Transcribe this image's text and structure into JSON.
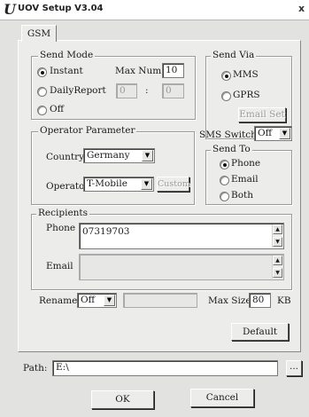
{
  "window": {
    "title": "UOV Setup V3.04",
    "close": "x"
  },
  "tabs": [
    {
      "label": "GSM"
    }
  ],
  "send_mode": {
    "label": "Send Mode",
    "instant": "Instant",
    "daily_report": "DailyReport",
    "off": "Off",
    "max_num_label": "Max Num",
    "max_num_value": "10",
    "daily_value_1": "0",
    "daily_separator": ":",
    "daily_value_2": "0",
    "selected": "Instant"
  },
  "send_via": {
    "label": "Send Via",
    "mms": "MMS",
    "gprs": "GPRS",
    "email_set": "Email Set",
    "selected": "MMS"
  },
  "operator_parameter": {
    "label": "Operator Parameter",
    "country_label": "Country",
    "country_value": "Germany",
    "operator_label": "Operator",
    "operator_value": "T-Mobile",
    "custom_button": "Custom"
  },
  "sms_switch": {
    "label": "SMS Switch",
    "value": "Off"
  },
  "send_to": {
    "label": "Send To",
    "phone": "Phone",
    "email": "Email",
    "both": "Both",
    "selected": "Phone"
  },
  "recipients": {
    "label": "Recipients",
    "phone_label": "Phone",
    "phone_value": "07319703",
    "email_label": "Email",
    "email_value": ""
  },
  "rename": {
    "label": "Rename",
    "value": "Off",
    "text": ""
  },
  "max_size": {
    "label": "Max Size",
    "value": "80",
    "unit": "KB"
  },
  "default_button": "Default",
  "path": {
    "label": "Path:",
    "value": "E:\\",
    "browse": "..."
  },
  "ok_button": "OK",
  "cancel_button": "Cancel"
}
